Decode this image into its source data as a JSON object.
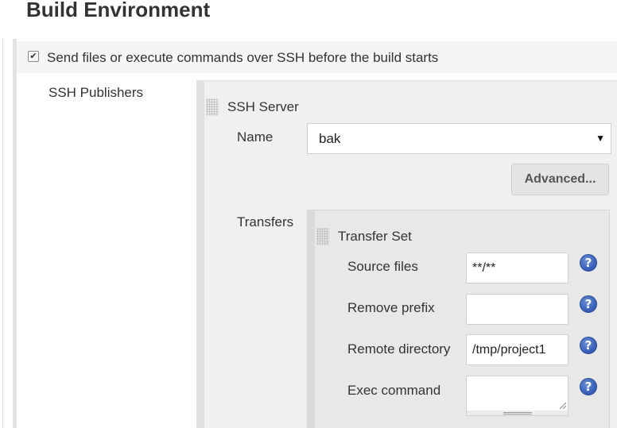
{
  "section": {
    "title": "Build Environment"
  },
  "ssh_before_build": {
    "checked": true,
    "checkmark": "✔",
    "label": "Send files or execute commands over SSH before the build starts"
  },
  "publishers": {
    "label": "SSH Publishers",
    "server": {
      "title": "SSH Server",
      "name_label": "Name",
      "name_value": "bak",
      "dropdown_arrow": "▼",
      "advanced_label": "Advanced..."
    },
    "transfers": {
      "label": "Transfers",
      "transfer_set": {
        "title": "Transfer Set",
        "fields": {
          "source_files": {
            "label": "Source files",
            "value": "**/**"
          },
          "remove_prefix": {
            "label": "Remove prefix",
            "value": ""
          },
          "remote_directory": {
            "label": "Remote directory",
            "value": "/tmp/project1"
          },
          "exec_command": {
            "label": "Exec command",
            "value": ""
          }
        },
        "help_glyph": "?"
      }
    }
  },
  "icons": {
    "checkbox": "checkbox-icon",
    "grip": "drag-handle-icon",
    "dropdown": "chevron-down-icon",
    "help": "help-icon"
  },
  "colors": {
    "help_blue": "#3a62b8",
    "panel_gray": "#f0f0f0",
    "transfer_gray": "#e8e8e8"
  }
}
